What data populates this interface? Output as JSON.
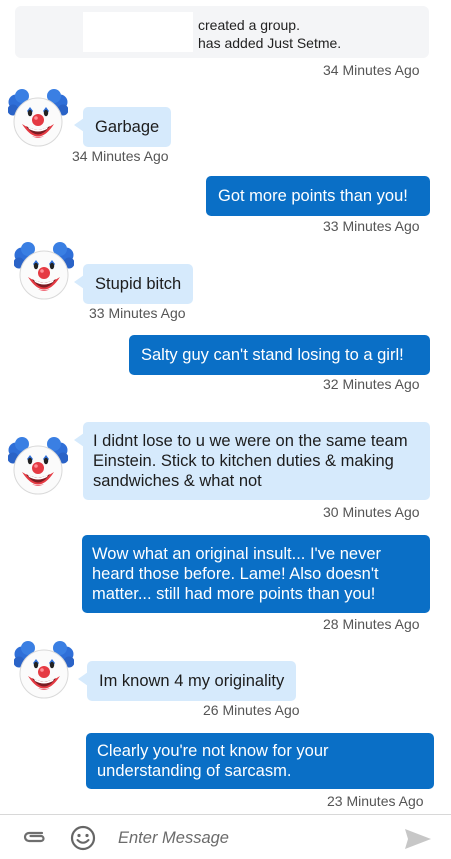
{
  "system_notice": {
    "line1": "created a group.",
    "line2": "has added Just Setme.",
    "time": "34 Minutes Ago"
  },
  "messages": [
    {
      "direction": "incoming",
      "text": "Garbage",
      "time": "34 Minutes Ago"
    },
    {
      "direction": "outgoing",
      "text": "Got more points than you!",
      "time": "33 Minutes Ago"
    },
    {
      "direction": "incoming",
      "text": "Stupid bitch",
      "time": "33 Minutes Ago"
    },
    {
      "direction": "outgoing",
      "text": "Salty guy can't stand losing to a girl!",
      "time": "32 Minutes Ago"
    },
    {
      "direction": "incoming",
      "text": "I didnt lose to u we were on the same team Einstein. Stick to kitchen duties & making sandwiches & what not",
      "time": "30 Minutes Ago"
    },
    {
      "direction": "outgoing",
      "text": "Wow what an original insult... I've never heard those before. Lame! Also doesn't matter... still had more points than you!",
      "time": "28 Minutes Ago"
    },
    {
      "direction": "incoming",
      "text": "Im known 4 my originality",
      "time": "26 Minutes Ago"
    },
    {
      "direction": "outgoing",
      "text": "Clearly you're not know for your understanding of sarcasm.",
      "time": "23 Minutes Ago"
    }
  ],
  "avatar_icon": "clown-face-icon",
  "composer": {
    "placeholder": "Enter Message",
    "attach_icon": "paperclip-icon",
    "emoji_icon": "smiley-icon",
    "send_icon": "send-icon"
  },
  "colors": {
    "incoming_bubble": "#d6eafc",
    "outgoing_bubble": "#0a6fc6",
    "system_card": "#f4f5f7"
  }
}
